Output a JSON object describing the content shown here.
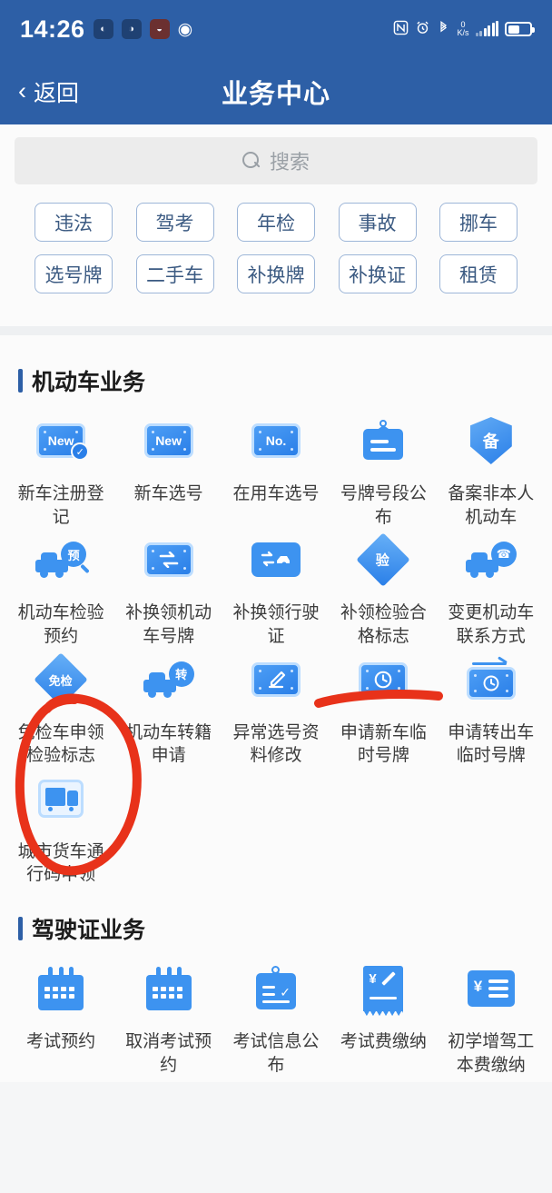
{
  "statusbar": {
    "time": "14:26",
    "badges": [
      "◐",
      "◑",
      "◒"
    ],
    "eye_icon": "◉",
    "nfc_label": "N",
    "alarm_icon": "⏰",
    "bluetooth_icon": "ᛗ",
    "net_speed_value": "0",
    "net_speed_unit": "K/s"
  },
  "navbar": {
    "back_label": "返回",
    "back_chevron": "‹",
    "title": "业务中心"
  },
  "search": {
    "placeholder": "搜索",
    "icon": "search-icon"
  },
  "tags": {
    "row1": [
      "违法",
      "驾考",
      "年检",
      "事故",
      "挪车"
    ],
    "row2": [
      "选号牌",
      "二手车",
      "补换牌",
      "补换证",
      "租赁"
    ]
  },
  "sections": [
    {
      "title": "机动车业务",
      "items": [
        {
          "label": "新车注册登记",
          "icon": "plate-new-check-icon",
          "icon_text": "New"
        },
        {
          "label": "新车选号",
          "icon": "plate-new-icon",
          "icon_text": "New"
        },
        {
          "label": "在用车选号",
          "icon": "plate-no-icon",
          "icon_text": "No."
        },
        {
          "label": "号牌号段公布",
          "icon": "signboard-icon",
          "icon_text": ""
        },
        {
          "label": "备案非本人机动车",
          "icon": "shield-bei-icon",
          "icon_text": "备"
        },
        {
          "label": "机动车检验预约",
          "icon": "car-magnifier-yu-icon",
          "icon_text": "预"
        },
        {
          "label": "补换领机动车号牌",
          "icon": "plate-exchange-icon",
          "icon_text": ""
        },
        {
          "label": "补换领行驶证",
          "icon": "card-car-exchange-icon",
          "icon_text": ""
        },
        {
          "label": "补领检验合格标志",
          "icon": "diamond-yan-icon",
          "icon_text": "验"
        },
        {
          "label": "变更机动车联系方式",
          "icon": "car-phone-icon",
          "icon_text": ""
        },
        {
          "label": "免检车申领检验标志",
          "icon": "diamond-mianjian-icon",
          "icon_text": "免检"
        },
        {
          "label": "机动车转籍申请",
          "icon": "car-zhuan-icon",
          "icon_text": "转"
        },
        {
          "label": "异常选号资料修改",
          "icon": "plate-pencil-icon",
          "icon_text": ""
        },
        {
          "label": "申请新车临时号牌",
          "icon": "plate-clock-icon",
          "icon_text": ""
        },
        {
          "label": "申请转出车临时号牌",
          "icon": "plate-clock-arrow-icon",
          "icon_text": ""
        },
        {
          "label": "城市货车通行码申领",
          "icon": "truck-box-icon",
          "icon_text": ""
        }
      ]
    },
    {
      "title": "驾驶证业务",
      "items": [
        {
          "label": "考试预约",
          "icon": "calendar-icon",
          "icon_text": ""
        },
        {
          "label": "取消考试预约",
          "icon": "calendar-icon",
          "icon_text": ""
        },
        {
          "label": "考试信息公布",
          "icon": "clipboard-check-icon",
          "icon_text": ""
        },
        {
          "label": "考试费缴纳",
          "icon": "receipt-yen-pencil-icon",
          "icon_text": "¥"
        },
        {
          "label": "初学增驾工本费缴纳",
          "icon": "card-yen-lines-icon",
          "icon_text": "¥"
        }
      ]
    }
  ],
  "annotations": {
    "circle_target": "免检车申领检验标志",
    "underline_target": "补领检验合格标志",
    "color": "#e8321a"
  },
  "theme": {
    "header_blue": "#2d5fa6",
    "icon_blue": "#3d93f0",
    "tag_border": "#9db6d8"
  }
}
